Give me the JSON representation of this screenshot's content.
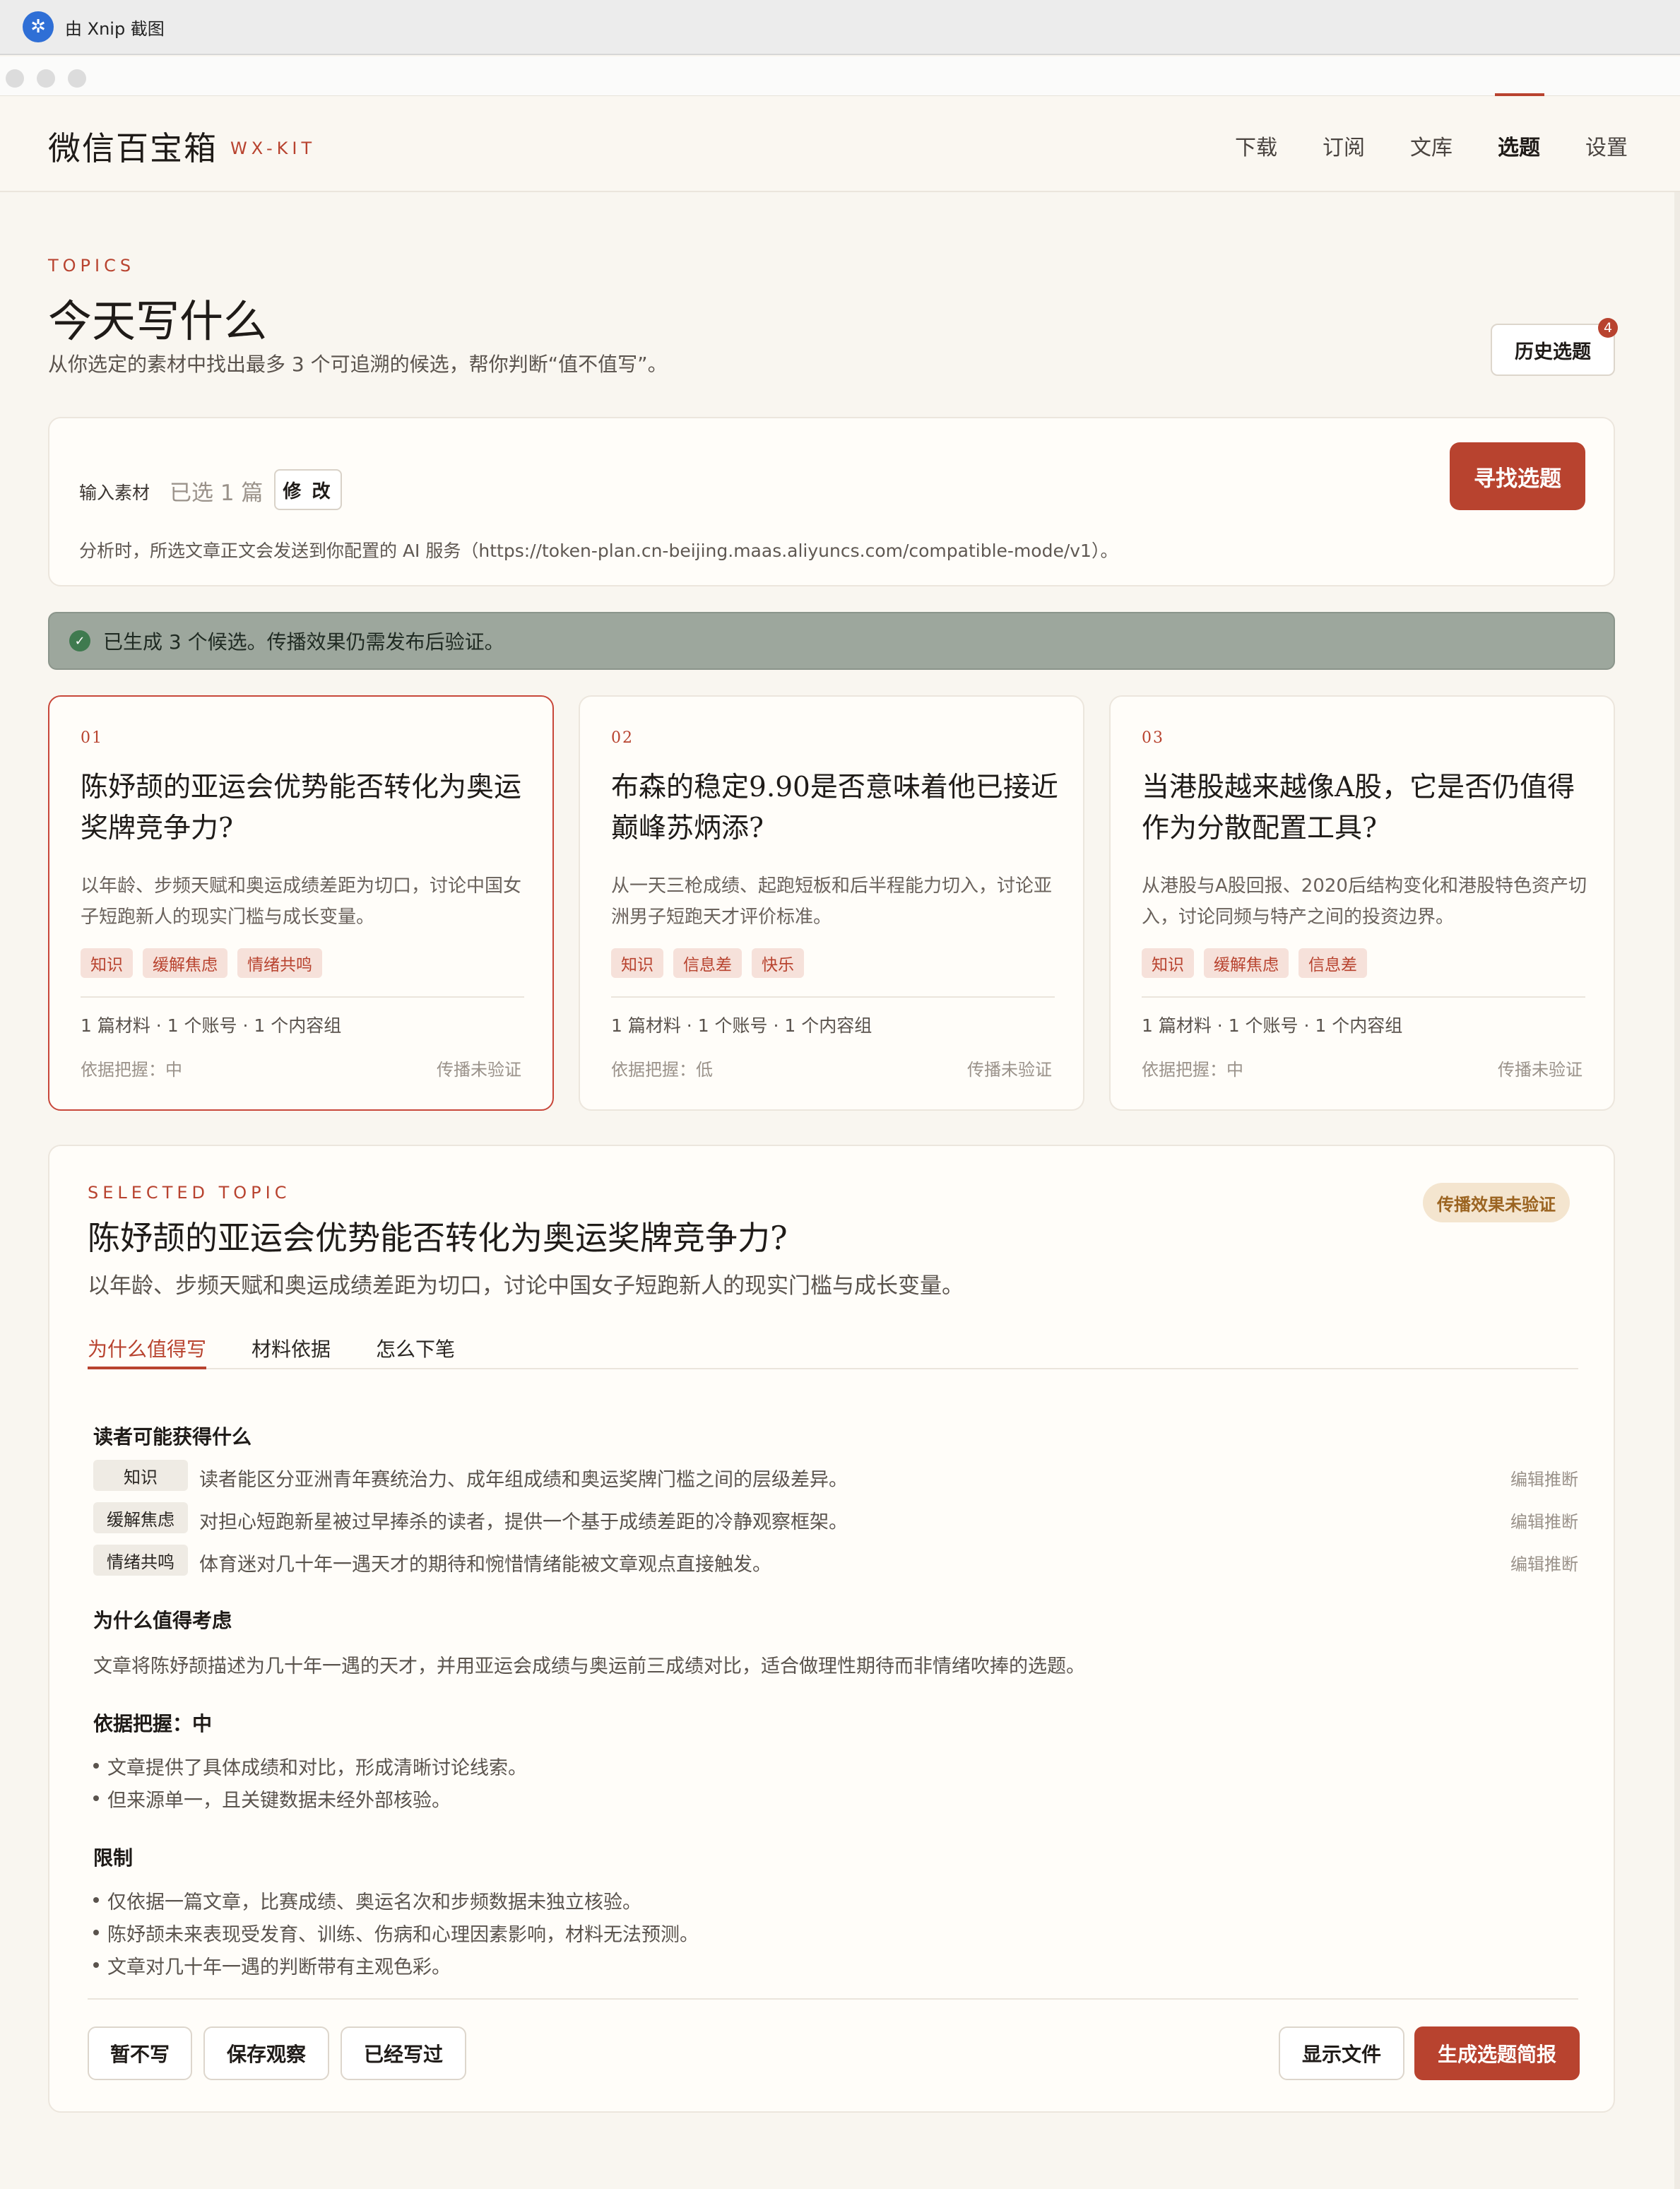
{
  "capture_bar": {
    "title": "由 Xnip 截图"
  },
  "header": {
    "brand": "微信百宝箱",
    "brand_sub": "WX-KIT",
    "nav": [
      "下载",
      "订阅",
      "文库",
      "选题",
      "设置"
    ],
    "active_nav": "选题"
  },
  "intro": {
    "eyebrow": "TOPICS",
    "title": "今天写什么",
    "subtitle": "从你选定的素材中找出最多 3 个可追溯的候选，帮你判断“值不值写”。",
    "history_button": "历史选题",
    "history_badge": "4"
  },
  "input": {
    "label": "输入素材",
    "selected": "已选 1 篇",
    "edit_button": "修 改",
    "note": "分析时，所选文章正文会发送到你配置的 AI 服务（https://token-plan.cn-beijing.maas.aliyuncs.com/compatible-mode/v1）。",
    "find_button": "寻找选题"
  },
  "banner": {
    "text": "已生成 3 个候选。传播效果仍需发布后验证。"
  },
  "topics": [
    {
      "num": "01",
      "title": "陈妤颉的亚运会优势能否转化为奥运奖牌竞争力?",
      "desc": "以年龄、步频天赋和奥运成绩差距为切口，讨论中国女子短跑新人的现实门槛与成长变量。",
      "tags": [
        "知识",
        "缓解焦虑",
        "情绪共鸣"
      ],
      "meta": "1 篇材料 · 1 个账号 · 1 个内容组",
      "confidence": "依据把握：中",
      "verify": "传播未验证"
    },
    {
      "num": "02",
      "title": "布森的稳定9.90是否意味着他已接近巅峰苏炳添?",
      "desc": "从一天三枪成绩、起跑短板和后半程能力切入，讨论亚洲男子短跑天才评价标准。",
      "tags": [
        "知识",
        "信息差",
        "快乐"
      ],
      "meta": "1 篇材料 · 1 个账号 · 1 个内容组",
      "confidence": "依据把握：低",
      "verify": "传播未验证"
    },
    {
      "num": "03",
      "title": "当港股越来越像A股，它是否仍值得作为分散配置工具?",
      "desc": "从港股与A股回报、2020后结构变化和港股特色资产切入，讨论同频与特产之间的投资边界。",
      "tags": [
        "知识",
        "缓解焦虑",
        "信息差"
      ],
      "meta": "1 篇材料 · 1 个账号 · 1 个内容组",
      "confidence": "依据把握：中",
      "verify": "传播未验证"
    }
  ],
  "detail": {
    "eyebrow": "SELECTED TOPIC",
    "status": "传播效果未验证",
    "title": "陈妤颉的亚运会优势能否转化为奥运奖牌竞争力?",
    "subtitle": "以年龄、步频天赋和奥运成绩差距为切口，讨论中国女子短跑新人的现实门槛与成长变量。",
    "tabs": [
      "为什么值得写",
      "材料依据",
      "怎么下笔"
    ],
    "gains_heading": "读者可能获得什么",
    "gains": [
      {
        "tag": "知识",
        "text": "读者能区分亚洲青年赛统治力、成年组成绩和奥运奖牌门槛之间的层级差异。",
        "edit": "编辑推断"
      },
      {
        "tag": "缓解焦虑",
        "text": "对担心短跑新星被过早捧杀的读者，提供一个基于成绩差距的冷静观察框架。",
        "edit": "编辑推断"
      },
      {
        "tag": "情绪共鸣",
        "text": "体育迷对几十年一遇天才的期待和惋惜情绪能被文章观点直接触发。",
        "edit": "编辑推断"
      }
    ],
    "why_heading": "为什么值得考虑",
    "why_text": "文章将陈妤颉描述为几十年一遇的天才，并用亚运会成绩与奥运前三成绩对比，适合做理性期待而非情绪吹捧的选题。",
    "basis_heading": "依据把握：中",
    "basis": [
      "文章提供了具体成绩和对比，形成清晰讨论线索。",
      "但来源单一，且关键数据未经外部核验。"
    ],
    "limits_heading": "限制",
    "limits": [
      "仅依据一篇文章，比赛成绩、奥运名次和步频数据未独立核验。",
      "陈妤颉未来表现受发育、训练、伤病和心理因素影响，材料无法预测。",
      "文章对几十年一遇的判断带有主观色彩。"
    ],
    "buttons": {
      "skip": "暂不写",
      "save": "保存观察",
      "written": "已经写过",
      "show_file": "显示文件",
      "generate": "生成选题简报"
    }
  },
  "colors": {
    "accent": "#b8432f",
    "banner": "#9da79d",
    "status_bg": "#f4e5cf"
  }
}
